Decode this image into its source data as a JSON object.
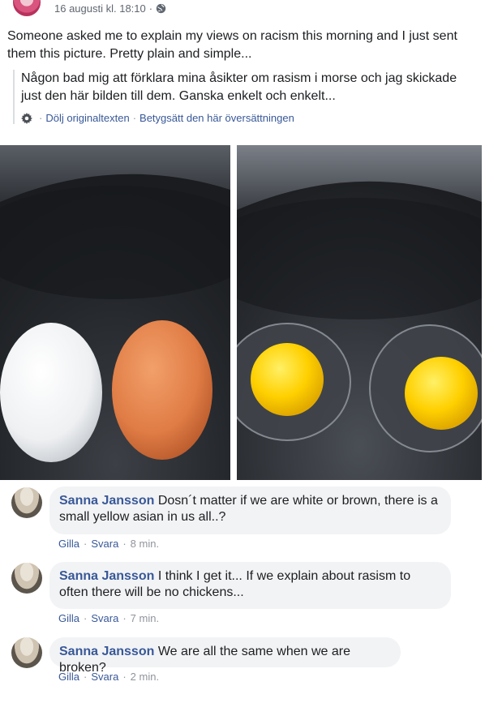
{
  "post": {
    "date": "16 augusti kl. 18:10",
    "separator": "·",
    "text": "Someone asked me to explain my views on racism this morning and I just sent them this picture. Pretty plain and simple...",
    "translation": "Någon bad mig att förklara mina åsikter om rasism i morse och jag skickade just den här bilden till dem. Ganska enkelt och enkelt...",
    "hide_original_label": "Dölj originaltexten",
    "rate_translation_label": "Betygsätt den här översättningen"
  },
  "icons": {
    "privacy": "globe-icon",
    "translation_settings": "gear-icon"
  },
  "colors": {
    "link": "#385898",
    "bubble": "#f2f3f5",
    "meta": "#606770"
  },
  "comments": [
    {
      "author": "Sanna Jansson",
      "text": "Dosn´t matter if we are white or brown, there is a small yellow asian in us all..?",
      "like": "Gilla",
      "reply": "Svara",
      "time": "8 min."
    },
    {
      "author": "Sanna Jansson",
      "text": "I think I get it... If we explain about rasism to often there will be no chickens...",
      "like": "Gilla",
      "reply": "Svara",
      "time": "7 min."
    },
    {
      "author": "Sanna Jansson",
      "text": "We are all the same when we are broken?",
      "like": "Gilla",
      "reply": "Svara",
      "time": "2 min."
    }
  ]
}
